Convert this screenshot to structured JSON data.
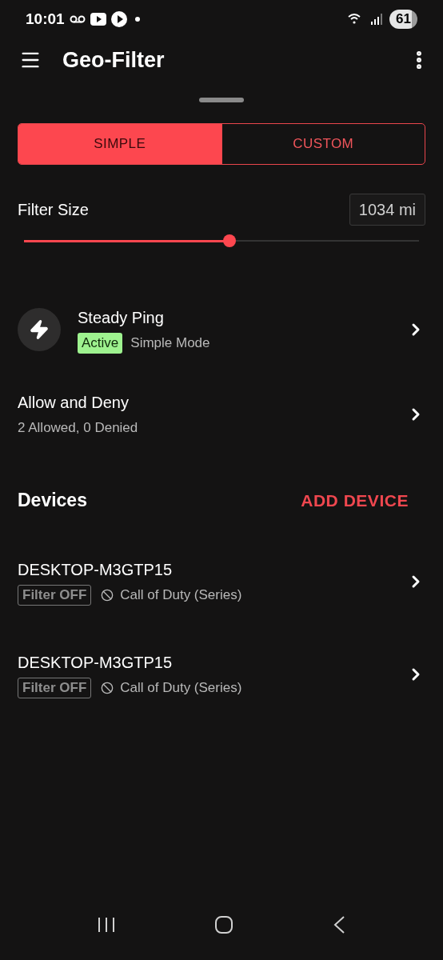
{
  "status_bar": {
    "time": "10:01",
    "battery": "61"
  },
  "app_bar": {
    "title": "Geo-Filter"
  },
  "mode_tabs": [
    {
      "label": "SIMPLE",
      "selected": true
    },
    {
      "label": "CUSTOM",
      "selected": false
    }
  ],
  "filter_size": {
    "label": "Filter Size",
    "reading": "1034 mi",
    "level": 0.52
  },
  "settings": [
    {
      "kind": "mode",
      "title": "Steady Ping",
      "badge": "Active",
      "subtitle": "Simple Mode"
    },
    {
      "kind": "plain",
      "title": "Allow and Deny",
      "subtitle": "2 Allowed, 0 Denied"
    }
  ],
  "devices": {
    "heading": "Devices",
    "action": "ADD DEVICE",
    "items": [
      {
        "name": "DESKTOP-M3GTP15",
        "filter": "Filter OFF",
        "game": "Call of Duty (Series)"
      },
      {
        "name": "DESKTOP-M3GTP15",
        "filter": "Filter OFF",
        "game": "Call of Duty (Series)"
      }
    ]
  }
}
